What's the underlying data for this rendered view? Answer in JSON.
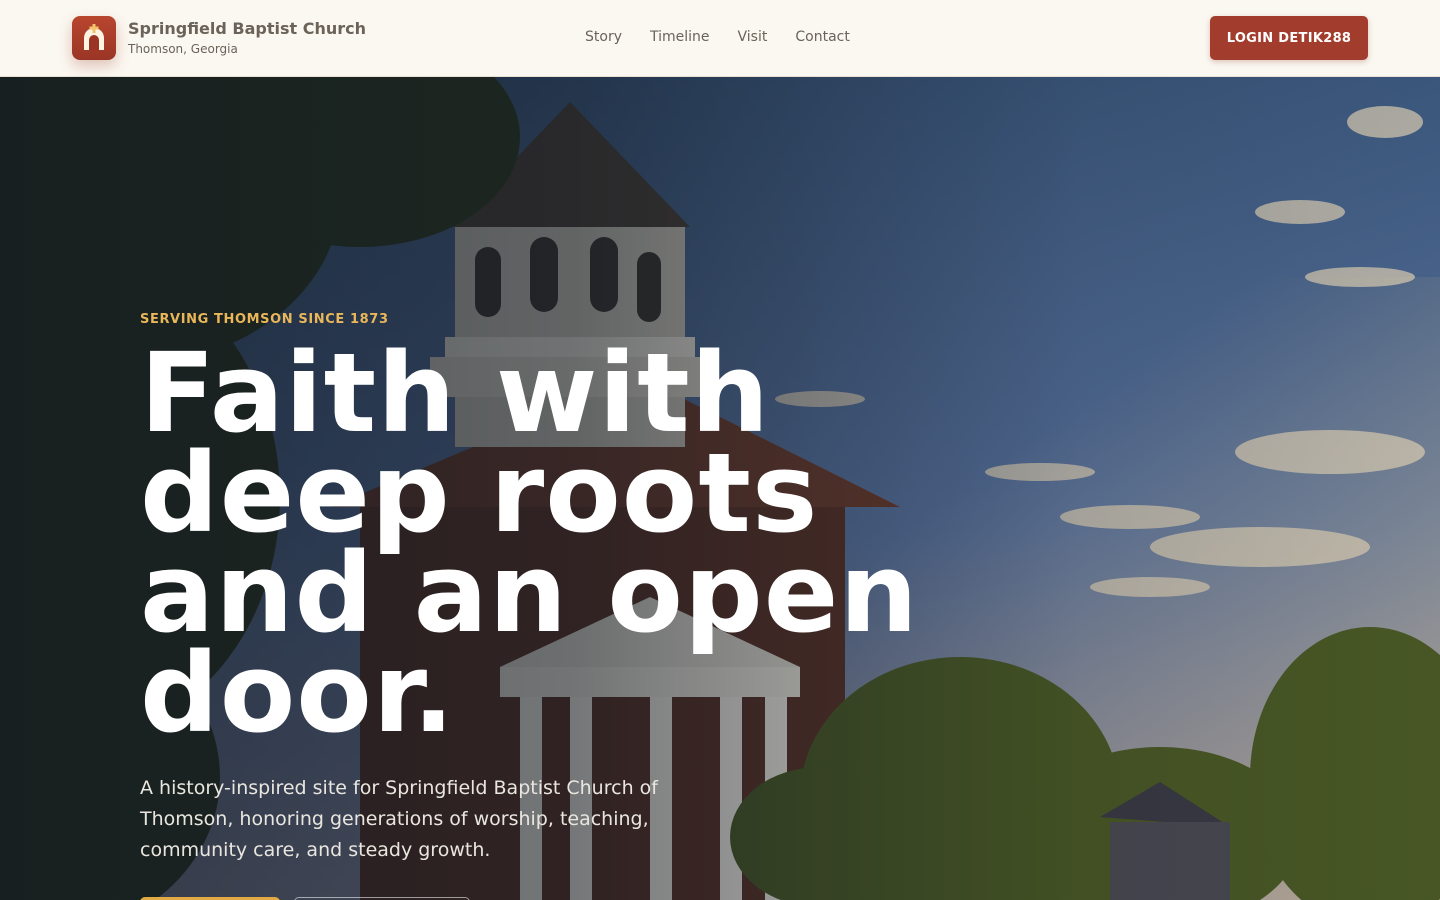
{
  "brand": {
    "name": "Springfield Baptist Church",
    "location": "Thomson, Georgia",
    "logo_icon": "church-door-cross-icon",
    "accent": "#a23c2c"
  },
  "nav": {
    "items": [
      {
        "label": "Story"
      },
      {
        "label": "Timeline"
      },
      {
        "label": "Visit"
      },
      {
        "label": "Contact"
      }
    ]
  },
  "header": {
    "login_label": "LOGIN DETIK288"
  },
  "hero": {
    "eyebrow": "SERVING THOMSON SINCE 1873",
    "headline": "Faith with deep roots and an open door.",
    "lede": "A history-inspired site for Springfield Baptist Church of Thomson, honoring generations of worship, teaching, community care, and steady growth.",
    "eyebrow_color": "#e9b65a",
    "primary_cta_color": "#e2a944"
  }
}
